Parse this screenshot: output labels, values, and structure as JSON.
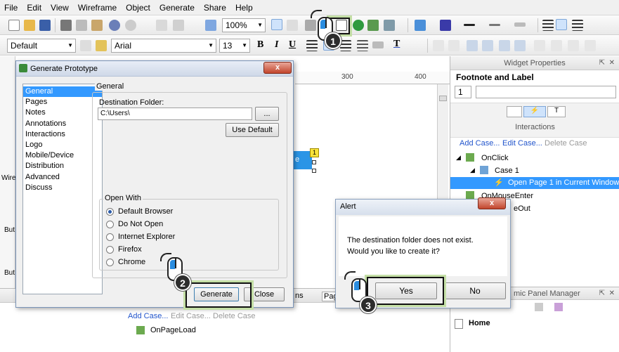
{
  "menu": [
    "File",
    "Edit",
    "View",
    "Wireframe",
    "Object",
    "Generate",
    "Share",
    "Help"
  ],
  "toolbar": {
    "zoom": "100%",
    "style": "Default",
    "font": "Arial",
    "font_size": "13",
    "bold": "B",
    "italic": "I",
    "underline": "U",
    "text_color": "T"
  },
  "ruler": {
    "marks": [
      "300",
      "400"
    ]
  },
  "canvas": {
    "widget_badge": "1",
    "widget_text": "e"
  },
  "left_partial": {
    "wire": "Wire",
    "but1": "But",
    "but2": "But"
  },
  "dialog": {
    "title": "Generate Prototype",
    "close": "x",
    "nav": [
      "General",
      "Pages",
      "Notes",
      "Annotations",
      "Interactions",
      "Logo",
      "Mobile/Device",
      "Distribution",
      "Advanced",
      "Discuss"
    ],
    "general_label": "General",
    "dest_label": "Destination Folder:",
    "dest_value": "C:\\Users\\",
    "browse": "...",
    "use_default": "Use Default",
    "open_with_label": "Open With",
    "open_with": [
      "Default Browser",
      "Do Not Open",
      "Internet Explorer",
      "Firefox",
      "Chrome"
    ],
    "generate": "Generate",
    "close_btn": "Close"
  },
  "alert": {
    "title": "Alert",
    "close": "x",
    "message_line1": "The destination folder does not exist.",
    "message_line2": "Would you like to create it?",
    "yes": "Yes",
    "no": "No"
  },
  "widget_properties": {
    "title": "Widget Properties",
    "widget_name": "Footnote and Label",
    "footnote": "1",
    "tab_label": "Interactions",
    "add_case": "Add Case...",
    "edit_case": "Edit Case...",
    "delete_case": "Delete Case",
    "tree": [
      "OnClick",
      "Case 1",
      "Open Page 1 in Current Window",
      "OnMouseEnter",
      "eOut"
    ]
  },
  "dynamic_panel": {
    "title": "mic Panel Manager",
    "home": "Home"
  },
  "bottom_tabs": [
    "ns",
    "Pag"
  ],
  "bottom_cases": {
    "add_case": "Add Case...",
    "edit_case": "Edit Case...",
    "delete_case": "Delete Case",
    "on_page_load": "OnPageLoad"
  },
  "callouts": [
    "1",
    "2",
    "3"
  ],
  "colors": {
    "selection": "#3399ff",
    "highlight_ring": "#c4dfa6",
    "link": "#2255cc",
    "tree_selected": "#3399ff"
  }
}
